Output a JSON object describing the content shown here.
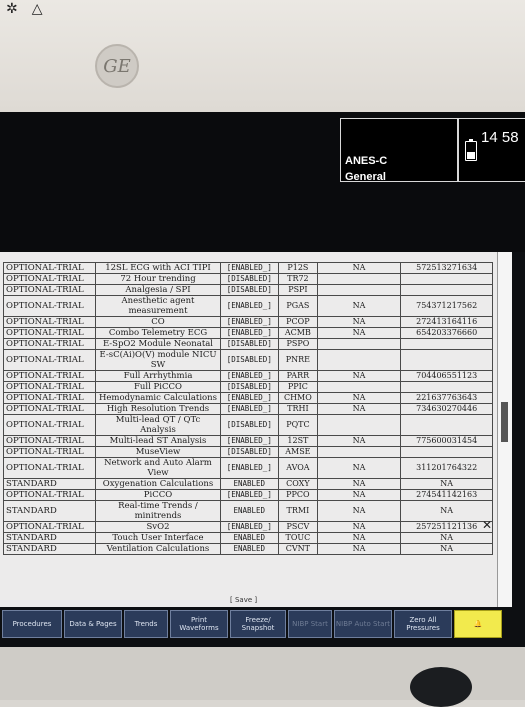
{
  "top_icons": [
    "✲",
    "△"
  ],
  "logo_text": "GE",
  "header": {
    "patient_name": "ANES-C",
    "care_unit": "General",
    "time": "14 58"
  },
  "table": {
    "rows": [
      {
        "state": "OPTIONAL-TRIAL",
        "name": "12SL ECG with ACI TIPI",
        "status": "[ENABLED_]",
        "code": "P12S",
        "expiry": "NA",
        "key": "572513271634"
      },
      {
        "state": "OPTIONAL-TRIAL",
        "name": "72 Hour trending",
        "status": "[DISABLED]",
        "code": "TR72",
        "expiry": "",
        "key": ""
      },
      {
        "state": "OPTIONAL-TRIAL",
        "name": "Analgesia / SPI",
        "status": "[DISABLED]",
        "code": "PSPI",
        "expiry": "",
        "key": ""
      },
      {
        "state": "OPTIONAL-TRIAL",
        "name": "Anesthetic agent measurement",
        "status": "[ENABLED_]",
        "code": "PGAS",
        "expiry": "NA",
        "key": "754371217562"
      },
      {
        "state": "OPTIONAL-TRIAL",
        "name": "CO",
        "status": "[ENABLED_]",
        "code": "PCOP",
        "expiry": "NA",
        "key": "272413164116"
      },
      {
        "state": "OPTIONAL-TRIAL",
        "name": "Combo Telemetry ECG",
        "status": "[ENABLED_]",
        "code": "ACMB",
        "expiry": "NA",
        "key": "654203376660"
      },
      {
        "state": "OPTIONAL-TRIAL",
        "name": "E-SpO2 Module Neonatal",
        "status": "[DISABLED]",
        "code": "PSPO",
        "expiry": "",
        "key": ""
      },
      {
        "state": "OPTIONAL-TRIAL",
        "name": "E-sC(Ai)O(V) module NICU SW",
        "status": "[DISABLED]",
        "code": "PNRE",
        "expiry": "",
        "key": ""
      },
      {
        "state": "OPTIONAL-TRIAL",
        "name": "Full Arrhythmia",
        "status": "[ENABLED_]",
        "code": "PARR",
        "expiry": "NA",
        "key": "704406551123"
      },
      {
        "state": "OPTIONAL-TRIAL",
        "name": "Full PiCCO",
        "status": "[DISABLED]",
        "code": "PPIC",
        "expiry": "",
        "key": ""
      },
      {
        "state": "OPTIONAL-TRIAL",
        "name": "Hemodynamic Calculations",
        "status": "[ENABLED_]",
        "code": "CHMO",
        "expiry": "NA",
        "key": "221637763643"
      },
      {
        "state": "OPTIONAL-TRIAL",
        "name": "High Resolution Trends",
        "status": "[ENABLED_]",
        "code": "TRHI",
        "expiry": "NA",
        "key": "734630270446"
      },
      {
        "state": "OPTIONAL-TRIAL",
        "name": "Multi-lead QT / QTc Analysis",
        "status": "[DISABLED]",
        "code": "PQTC",
        "expiry": "",
        "key": ""
      },
      {
        "state": "OPTIONAL-TRIAL",
        "name": "Multi-lead ST Analysis",
        "status": "[ENABLED_]",
        "code": "12ST",
        "expiry": "NA",
        "key": "775600031454"
      },
      {
        "state": "OPTIONAL-TRIAL",
        "name": "MuseView",
        "status": "[DISABLED]",
        "code": "AMSE",
        "expiry": "",
        "key": ""
      },
      {
        "state": "OPTIONAL-TRIAL",
        "name": "Network and Auto Alarm View",
        "status": "[ENABLED_]",
        "code": "AVOA",
        "expiry": "NA",
        "key": "311201764322"
      },
      {
        "state": "STANDARD",
        "name": "Oxygenation Calculations",
        "status": "ENABLED",
        "code": "COXY",
        "expiry": "NA",
        "key": "NA"
      },
      {
        "state": "OPTIONAL-TRIAL",
        "name": "PiCCO",
        "status": "[ENABLED_]",
        "code": "PPCO",
        "expiry": "NA",
        "key": "274541142163"
      },
      {
        "state": "STANDARD",
        "name": "Real-time Trends / minitrends",
        "status": "ENABLED",
        "code": "TRMI",
        "expiry": "NA",
        "key": "NA"
      },
      {
        "state": "OPTIONAL-TRIAL",
        "name": "SvO2",
        "status": "[ENABLED_]",
        "code": "PSCV",
        "expiry": "NA",
        "key": "257251121136"
      },
      {
        "state": "STANDARD",
        "name": "Touch User Interface",
        "status": "ENABLED",
        "code": "TOUC",
        "expiry": "NA",
        "key": "NA"
      },
      {
        "state": "STANDARD",
        "name": "Ventilation Calculations",
        "status": "ENABLED",
        "code": "CVNT",
        "expiry": "NA",
        "key": "NA"
      }
    ],
    "save_label": "[ Save ]"
  },
  "softkeys": [
    {
      "label": "Procedures",
      "enabled": true
    },
    {
      "label": "Data & Pages",
      "enabled": true
    },
    {
      "label": "Trends",
      "enabled": true
    },
    {
      "label": "Print Waveforms",
      "enabled": true
    },
    {
      "label": "Freeze/ Snapshot",
      "enabled": true
    },
    {
      "label": "NIBP Start",
      "enabled": false
    },
    {
      "label": "NIBP Auto Start",
      "enabled": false
    },
    {
      "label": "Zero All Pressures",
      "enabled": true
    },
    {
      "label": "🔔",
      "enabled": true,
      "alarm": true
    }
  ]
}
